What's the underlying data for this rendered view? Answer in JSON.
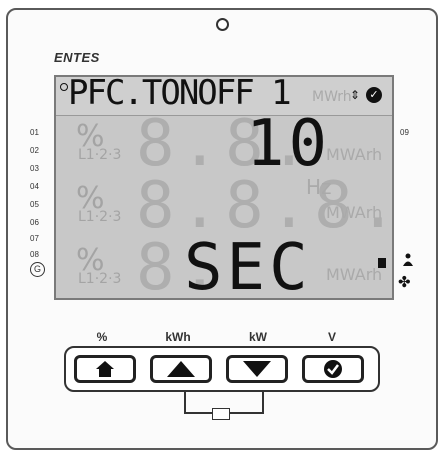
{
  "brand": {
    "logo": "ENTES"
  },
  "display": {
    "top_line": "PFC.TONOFF 1",
    "top_unit_ghost": "MWrh",
    "row1": {
      "ghost_prefix": "%",
      "ghost_sub": "L1·2·3",
      "ghost_digits": "8.8.",
      "value": "10",
      "unit_ghost": "MWArh"
    },
    "row2": {
      "ghost_prefix": "%",
      "ghost_sub": "L1·2·3",
      "ghost_digits": "8.8.8.8",
      "unit_ghost_hz": "Hz",
      "unit_ghost": "MWArh"
    },
    "row3": {
      "ghost_prefix": "%",
      "ghost_sub": "L1·2·3",
      "ghost_digits": "8.",
      "value": "SEC",
      "unit_ghost": "MWArh"
    }
  },
  "left_indicators": [
    "01",
    "02",
    "03",
    "04",
    "05",
    "06",
    "07",
    "08"
  ],
  "right_indicator": "09",
  "generator_indicator": "G",
  "button_labels": [
    "%",
    "kWh",
    "kW",
    "V"
  ],
  "colors": {
    "lcd_bg": "#c8c8c8",
    "segment_on": "#111111",
    "segment_off": "#aeaeae"
  }
}
